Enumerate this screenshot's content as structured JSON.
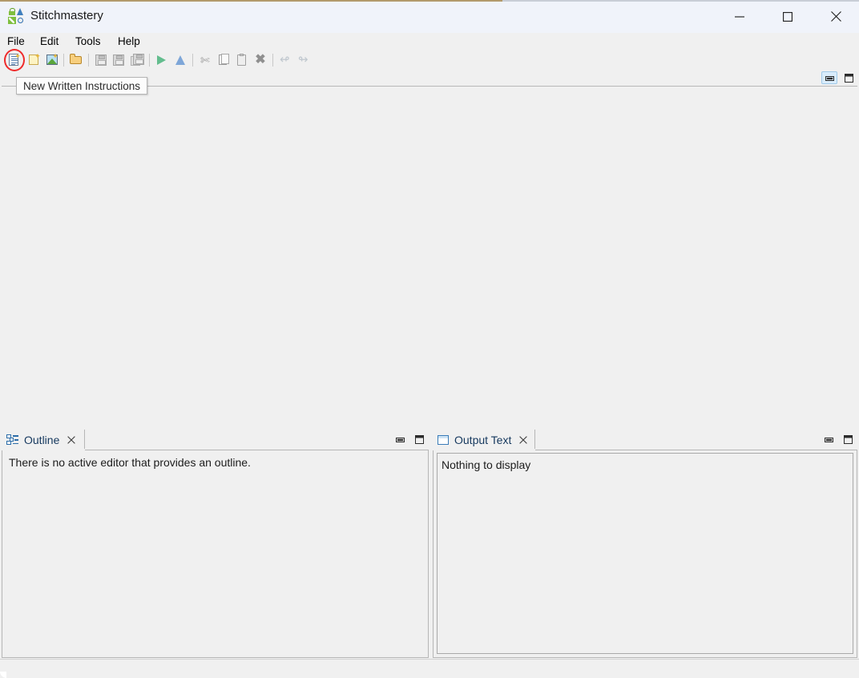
{
  "window": {
    "title": "Stitchmastery",
    "app_icon": "stitchmastery-logo-icon",
    "controls": {
      "minimize": "minimize-icon",
      "maximize": "maximize-icon",
      "close": "close-icon"
    },
    "accent_active": "#b29a6b",
    "titlebar_bg": "#f0f3fa"
  },
  "menubar": {
    "items": [
      {
        "label": "File"
      },
      {
        "label": "Edit"
      },
      {
        "label": "Tools"
      },
      {
        "label": "Help"
      }
    ]
  },
  "toolbar": {
    "buttons": [
      {
        "name": "new-written-instructions",
        "icon": "new-document-icon",
        "enabled": true,
        "highlighted": true
      },
      {
        "name": "new-note",
        "icon": "new-note-icon",
        "enabled": true
      },
      {
        "name": "new-chart",
        "icon": "new-chart-image-icon",
        "enabled": true
      },
      {
        "name": "open",
        "icon": "open-folder-icon",
        "enabled": true
      },
      {
        "name": "save",
        "icon": "save-icon",
        "enabled": false
      },
      {
        "name": "save-as",
        "icon": "save-as-icon",
        "enabled": false
      },
      {
        "name": "save-all",
        "icon": "save-all-icon",
        "enabled": false
      },
      {
        "name": "run",
        "icon": "play-icon",
        "enabled": true
      },
      {
        "name": "build",
        "icon": "triangle-up-icon",
        "enabled": true
      },
      {
        "name": "cut",
        "icon": "scissors-icon",
        "enabled": false
      },
      {
        "name": "copy",
        "icon": "copy-icon",
        "enabled": false
      },
      {
        "name": "paste",
        "icon": "paste-icon",
        "enabled": false
      },
      {
        "name": "delete",
        "icon": "delete-x-icon",
        "enabled": false
      },
      {
        "name": "undo",
        "icon": "undo-arrow-icon",
        "enabled": false
      },
      {
        "name": "redo",
        "icon": "redo-arrow-icon",
        "enabled": false
      }
    ]
  },
  "tooltip": {
    "text": "New Written Instructions",
    "visible": true
  },
  "annotation": {
    "shape": "circle",
    "color": "#ef2a2a",
    "target": "new-written-instructions"
  },
  "editor": {
    "tabs": [],
    "minimize_label": "minimize-panel-icon",
    "maximize_label": "maximize-panel-icon",
    "empty": true
  },
  "panels": {
    "outline": {
      "tab_label": "Outline",
      "tab_icon": "outline-tree-icon",
      "close_icon": "close-tab-icon",
      "message": "There is no active editor that provides an outline.",
      "minimize_label": "minimize-panel-icon",
      "maximize_label": "maximize-panel-icon",
      "active": true
    },
    "output": {
      "tab_label": "Output Text",
      "tab_icon": "output-window-icon",
      "close_icon": "close-tab-icon",
      "message": "Nothing to display",
      "minimize_label": "minimize-panel-icon",
      "maximize_label": "maximize-panel-icon",
      "active": true
    }
  }
}
